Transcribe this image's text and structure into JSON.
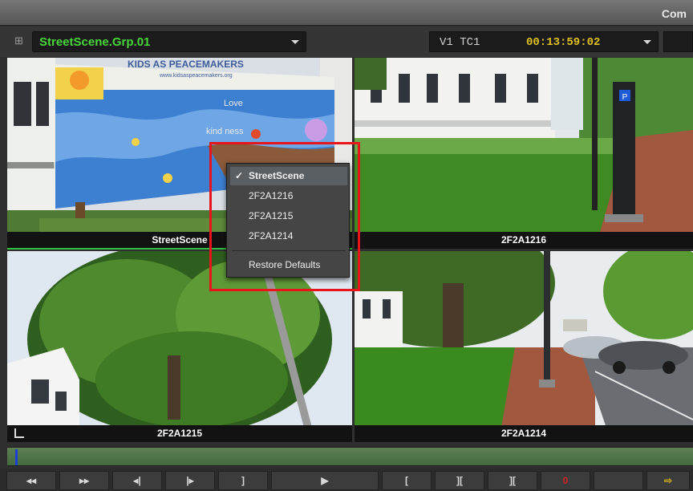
{
  "window": {
    "title": "Com"
  },
  "toolbar": {
    "grid_icon": "grid-icon",
    "sequence_name": "StreetScene.Grp.01",
    "track": "V1 TC1",
    "timecode": "00:13:59:02"
  },
  "monitors": [
    {
      "label": "StreetScene"
    },
    {
      "label": "2F2A1216"
    },
    {
      "label": "2F2A1215"
    },
    {
      "label": "2F2A1214"
    }
  ],
  "mural_text": {
    "line1": "KIDS AS PEACEMAKERS",
    "line2": "www.kidsaspeacemakers.org",
    "line3": "Love",
    "line4": "kind ness"
  },
  "context_menu": {
    "items": [
      {
        "label": "StreetScene",
        "checked": true,
        "check": "✓"
      },
      {
        "label": "2F2A1216",
        "checked": false
      },
      {
        "label": "2F2A1215",
        "checked": false
      },
      {
        "label": "2F2A1214",
        "checked": false
      }
    ],
    "restore_label": "Restore Defaults"
  },
  "transport": {
    "buttons": [
      {
        "name": "rewind-icon",
        "glyph": "◂◂"
      },
      {
        "name": "fast-forward-icon",
        "glyph": "▸▸"
      },
      {
        "name": "step-back-icon",
        "glyph": "◂|"
      },
      {
        "name": "step-forward-icon",
        "glyph": "|▸"
      },
      {
        "name": "mark-out-icon",
        "glyph": "]"
      },
      {
        "name": "play-icon",
        "glyph": "▶"
      },
      {
        "name": "mark-in-icon",
        "glyph": "["
      },
      {
        "name": "mark-clip-icon",
        "glyph": "]["
      },
      {
        "name": "clear-marks-icon",
        "glyph": "]["
      },
      {
        "name": "counter",
        "glyph": "0"
      },
      {
        "name": "blank",
        "glyph": ""
      },
      {
        "name": "export-icon",
        "glyph": "⇨"
      }
    ]
  },
  "colors": {
    "sequence_text": "#48d63a",
    "timecode_text": "#e0c020",
    "highlight": "#e8141c",
    "timeline": "#4f7448",
    "playhead": "#1b3fd6"
  }
}
